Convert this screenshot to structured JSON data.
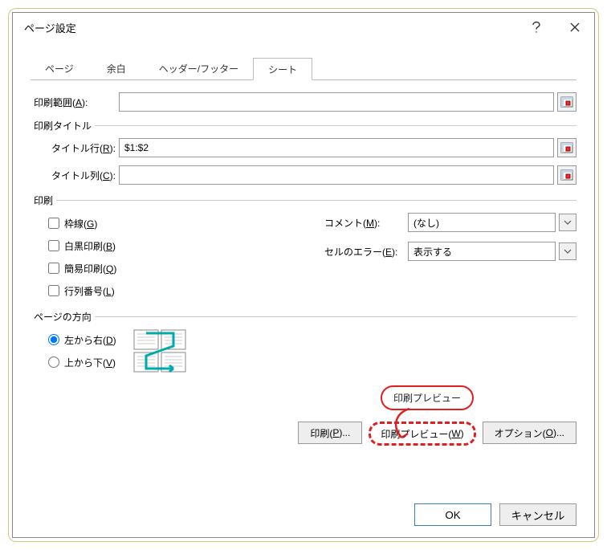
{
  "dialog": {
    "title": "ページ設定"
  },
  "tabs": {
    "page": "ページ",
    "margins": "余白",
    "headerfooter": "ヘッダー/フッター",
    "sheet": "シート"
  },
  "print_area": {
    "label_prefix": "印刷範囲(",
    "label_key": "A",
    "label_suffix": "):",
    "value": ""
  },
  "print_titles": {
    "group_label": "印刷タイトル",
    "rows_label_prefix": "タイトル行(",
    "rows_label_key": "R",
    "rows_label_suffix": "):",
    "rows_value": "$1:$2",
    "cols_label_prefix": "タイトル列(",
    "cols_label_key": "C",
    "cols_label_suffix": "):",
    "cols_value": ""
  },
  "print_section": {
    "group_label": "印刷",
    "gridlines_prefix": "枠線(",
    "gridlines_key": "G",
    "gridlines_suffix": ")",
    "bw_prefix": "白黒印刷(",
    "bw_key": "B",
    "bw_suffix": ")",
    "draft_prefix": "簡易印刷(",
    "draft_key": "Q",
    "draft_suffix": ")",
    "rowcol_prefix": "行列番号(",
    "rowcol_key": "L",
    "rowcol_suffix": ")",
    "comments_label_prefix": "コメント(",
    "comments_label_key": "M",
    "comments_label_suffix": "):",
    "comments_value": "(なし)",
    "errors_label_prefix": "セルのエラー(",
    "errors_label_key": "E",
    "errors_label_suffix": "):",
    "errors_value": "表示する"
  },
  "page_order": {
    "group_label": "ページの方向",
    "ltr_prefix": "左から右(",
    "ltr_key": "D",
    "ltr_suffix": ")",
    "ttb_prefix": "上から下(",
    "ttb_key": "V",
    "ttb_suffix": ")"
  },
  "buttons": {
    "print_prefix": "印刷(",
    "print_key": "P",
    "print_suffix": ")...",
    "preview_prefix": "印刷プレビュー(",
    "preview_key": "W",
    "preview_suffix": ")",
    "options_prefix": "オプション(",
    "options_key": "O",
    "options_suffix": ")...",
    "ok": "OK",
    "cancel": "キャンセル"
  },
  "annotation": {
    "callout": "印刷プレビュー"
  }
}
